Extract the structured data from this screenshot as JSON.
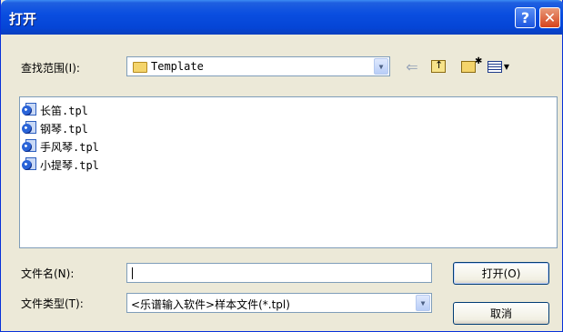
{
  "window": {
    "title": "打开"
  },
  "titlebar": {
    "help": "?",
    "close": "✕"
  },
  "lookin": {
    "label": "查找范围(I):",
    "value": "Template"
  },
  "files": [
    {
      "name": "长笛.tpl"
    },
    {
      "name": "钢琴.tpl"
    },
    {
      "name": "手风琴.tpl"
    },
    {
      "name": "小提琴.tpl"
    }
  ],
  "filename": {
    "label": "文件名(N):",
    "value": ""
  },
  "filetype": {
    "label": "文件类型(T):",
    "value": "<乐谱输入软件>样本文件(*.tpl)"
  },
  "buttons": {
    "open": "打开(O)",
    "cancel": "取消"
  }
}
